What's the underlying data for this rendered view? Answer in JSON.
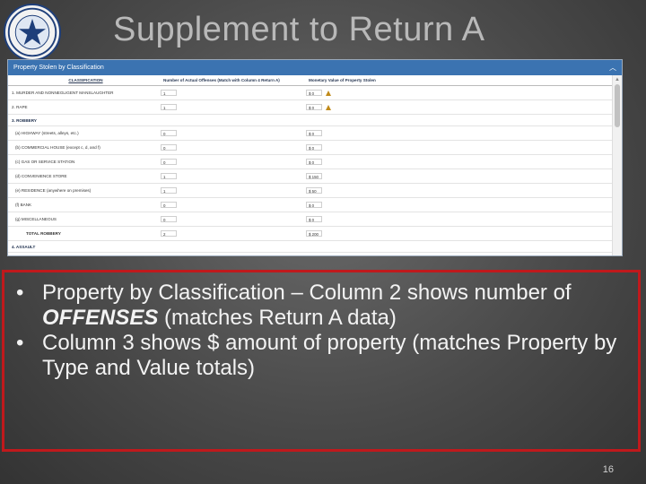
{
  "slide": {
    "title": "Supplement to Return A",
    "page_number": "16"
  },
  "seal_icon": "state-seal-icon",
  "panel": {
    "title": "Property Stolen by Classification",
    "columns": {
      "classification": "CLASSIFICATION",
      "offenses": "Number of Actual Offenses (Match with Column 4 Return A)",
      "value": "Monetary Value of Property Stolen"
    },
    "rows": [
      {
        "label": "1. MURDER AND NONNEGLIGENT MANSLAUGHTER",
        "offenses": "1",
        "value": "$ 0",
        "warn": true,
        "kind": "normal"
      },
      {
        "label": "2. RAPE",
        "offenses": "1",
        "value": "$ 0",
        "warn": true,
        "kind": "normal"
      },
      {
        "label": "3. ROBBERY",
        "kind": "section"
      },
      {
        "label": "(a) HIGHWAY (streets, alleys, etc.)",
        "offenses": "0",
        "value": "$ 0",
        "kind": "indent"
      },
      {
        "label": "(b) COMMERCIAL HOUSE (except c, d, and f)",
        "offenses": "0",
        "value": "$ 0",
        "kind": "indent"
      },
      {
        "label": "(c) GAS OR SERVICE STATION",
        "offenses": "0",
        "value": "$ 0",
        "kind": "indent"
      },
      {
        "label": "(d) CONVENIENCE STORE",
        "offenses": "1",
        "value": "$ 150",
        "kind": "indent"
      },
      {
        "label": "(e) RESIDENCE (anywhere on premises)",
        "offenses": "1",
        "value": "$ 50",
        "kind": "indent"
      },
      {
        "label": "(f) BANK",
        "offenses": "0",
        "value": "$ 0",
        "kind": "indent"
      },
      {
        "label": "(g) MISCELLANEOUS",
        "offenses": "0",
        "value": "$ 0",
        "kind": "indent"
      },
      {
        "label": "TOTAL ROBBERY",
        "offenses": "2",
        "value": "$ 200",
        "kind": "total"
      },
      {
        "label": "4. ASSAULT",
        "kind": "section"
      }
    ]
  },
  "bullets": [
    {
      "text_a": "Property by Classification – Column 2 shows number of ",
      "emph": "OFFENSES",
      "text_b": " (matches Return A data)"
    },
    {
      "text_a": "Column 3 shows $ amount of property (matches Property by Type and Value totals)",
      "emph": "",
      "text_b": ""
    }
  ],
  "colors": {
    "header": "#3b73b1",
    "highlight_border": "#c0191c",
    "warning": "#c08a1a"
  }
}
